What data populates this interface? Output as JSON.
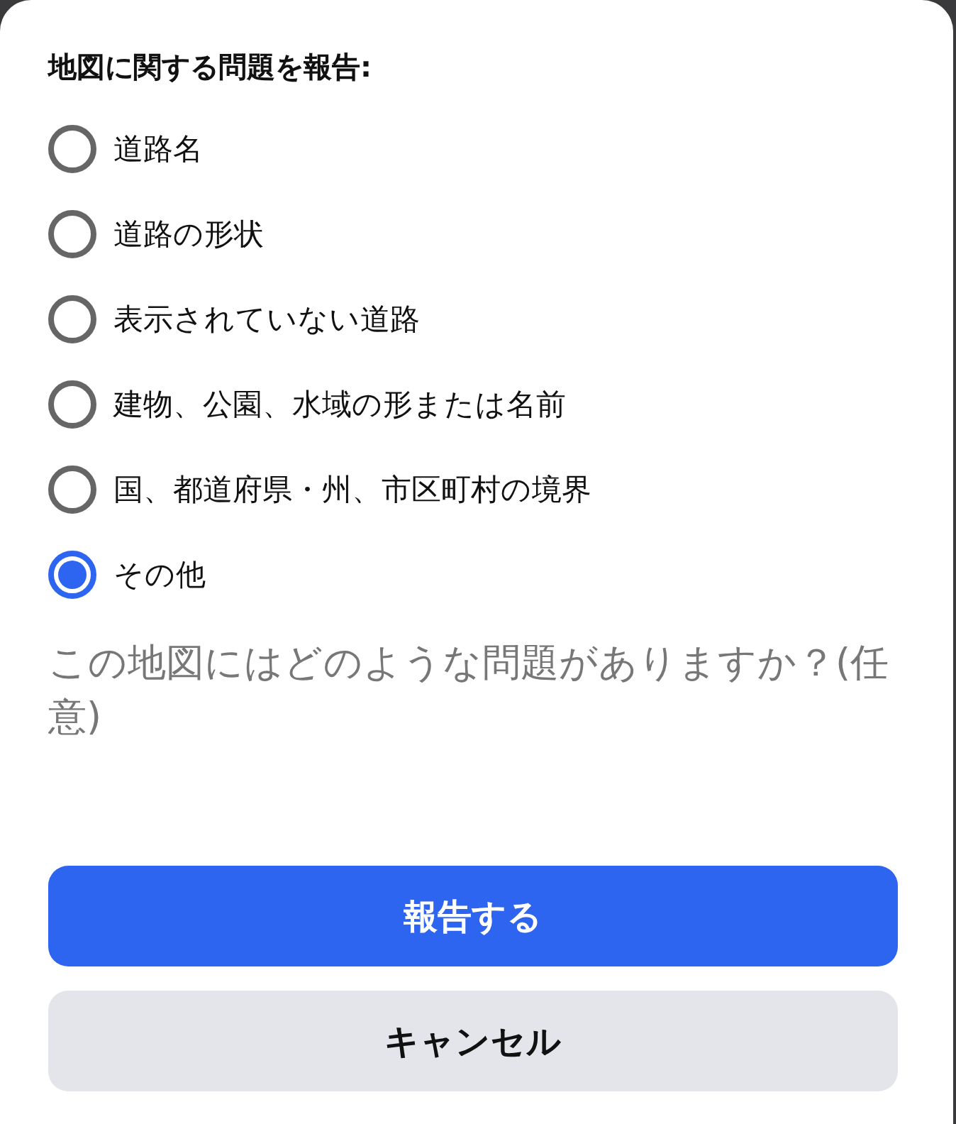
{
  "dialog": {
    "title": "地図に関する問題を報告:",
    "options": [
      {
        "label": "道路名",
        "selected": false
      },
      {
        "label": "道路の形状",
        "selected": false
      },
      {
        "label": "表示されていない道路",
        "selected": false
      },
      {
        "label": "建物、公園、水域の形または名前",
        "selected": false
      },
      {
        "label": "国、都道府県・州、市区町村の境界",
        "selected": false
      },
      {
        "label": "その他",
        "selected": true
      }
    ],
    "details": {
      "placeholder": "この地図にはどのような問題がありますか？(任意)"
    },
    "buttons": [
      {
        "label": "報告する",
        "kind": "primary"
      },
      {
        "label": "キャンセル",
        "kind": "secondary"
      }
    ]
  }
}
